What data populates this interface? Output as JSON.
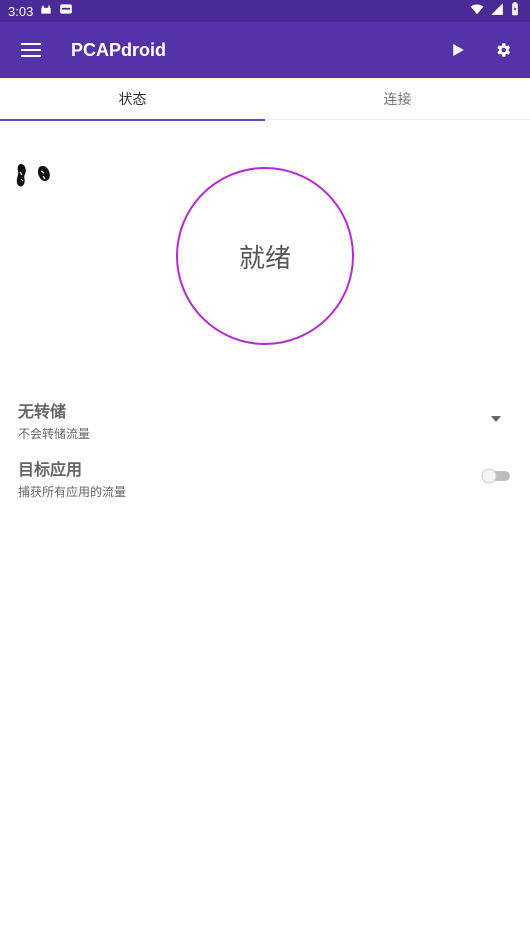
{
  "status_bar": {
    "time": "3:03"
  },
  "app_bar": {
    "title": "PCAPdroid"
  },
  "tabs": [
    {
      "label": "状态"
    },
    {
      "label": "连接"
    }
  ],
  "status": {
    "label": "就绪"
  },
  "settings": {
    "dump": {
      "title": "无转储",
      "subtitle": "不会转储流量"
    },
    "target_app": {
      "title": "目标应用",
      "subtitle": "捕获所有应用的流量",
      "enabled": false
    }
  },
  "colors": {
    "status_bar": "#4a2a96",
    "app_bar": "#5632a8",
    "accent": "#6a44c6",
    "circle": "#b52ad2"
  },
  "icons": {
    "menu": "menu-icon",
    "play": "play-icon",
    "settings": "gear-icon",
    "dropdown": "chevron-down-icon"
  }
}
